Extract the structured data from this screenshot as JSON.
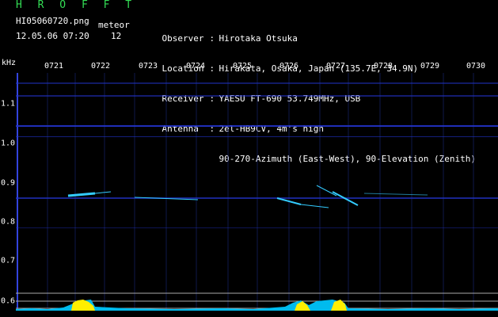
{
  "header": {
    "app_title": "H R O F F T",
    "filename": "HI05060720.png",
    "datetime": "12.05.06 07:20",
    "meteor_label": "meteor",
    "meteor_count": "12"
  },
  "station": {
    "observer_key": "Observer",
    "observer": "Hirotaka Otsuka",
    "location_key": "Location",
    "location": "Hirakata, Osaka, Japan (135.7E, 34.9N)",
    "receiver_key": "Receiver",
    "receiver": "YAESU FT-690 53.749MHz, USB",
    "antenna_key": "Antenna",
    "antenna": "2el-HB9CV, 4m's high",
    "antenna_line2": "90-270-Azimuth (East-West), 90-Elevation (Zenith)"
  },
  "colors": {
    "background": "#000000",
    "title": "#33dd55",
    "noise_band": "#2233cc",
    "echo": "#33ccff",
    "activity": "#00bbee",
    "activity_peak": "#ffee00"
  },
  "axes": {
    "unit": "kHz",
    "time_labels": [
      "0721",
      "0722",
      "0723",
      "0724",
      "0725",
      "0726",
      "0727",
      "0728",
      "0729",
      "0730"
    ],
    "freq_labels": [
      "1.1",
      "1.0",
      "0.9",
      "0.8",
      "0.7",
      "0.6"
    ]
  }
}
